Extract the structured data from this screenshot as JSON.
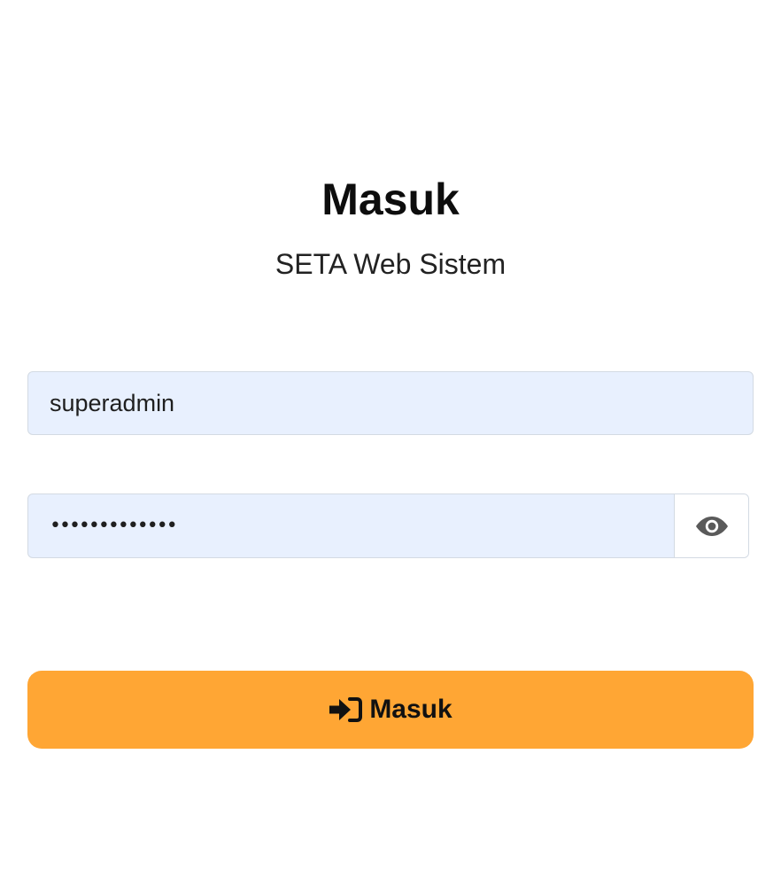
{
  "header": {
    "title": "Masuk",
    "subtitle": "SETA Web Sistem"
  },
  "form": {
    "username": {
      "value": "superadmin"
    },
    "password": {
      "masked_value": "•••••••••••••",
      "toggle_icon": "eye-icon"
    },
    "submit": {
      "label": "Masuk",
      "icon": "sign-in-icon",
      "color": "#ffa634"
    }
  },
  "colors": {
    "input_background": "#e8f0fe",
    "button_background": "#ffa634"
  }
}
